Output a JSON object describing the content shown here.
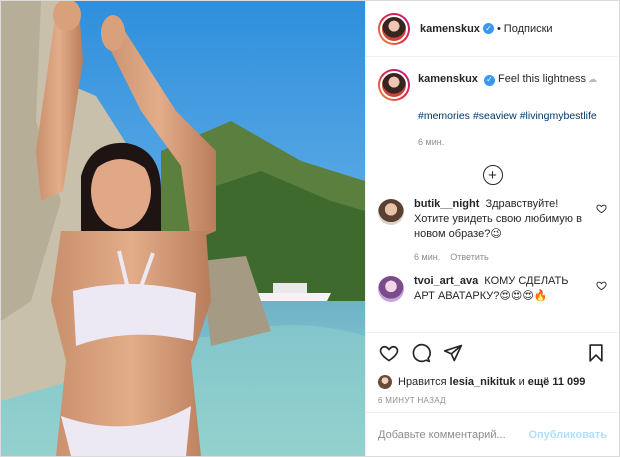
{
  "post": {
    "username": "kamenskux",
    "follow_label": "Подписки",
    "separator": "•"
  },
  "caption": {
    "username": "kamenskux",
    "text": "Feel this lightness",
    "hashtags": [
      "#memories",
      "#seaview",
      "#livingmybestlife"
    ],
    "time": "6 мин."
  },
  "comments": [
    {
      "username": "butik__night",
      "text": "Здравствуйте! Хотите увидеть свою любимую в новом образе?😉",
      "time": "6 мин.",
      "reply_label": "Ответить"
    },
    {
      "username": "tvoi_art_ava",
      "text": "КОМУ СДЕЛАТЬ АРТ АВАТАРКУ?😍😍😍🔥",
      "time": "",
      "reply_label": ""
    }
  ],
  "likes": {
    "prefix": "Нравится",
    "user": "lesia_nikituk",
    "conjunction": "и",
    "others": "ещё 11 099"
  },
  "timestamp": "6 МИНУТ НАЗАД",
  "comment_input": {
    "placeholder": "Добавьте комментарий...",
    "publish_label": "Опубликовать"
  },
  "icons": {
    "verified": "verified-badge-icon",
    "like": "heart-icon",
    "comment": "comment-bubble-icon",
    "share": "paper-plane-icon",
    "save": "bookmark-icon",
    "load_more": "plus-circle-icon"
  },
  "colors": {
    "verified_blue": "#3897f0",
    "hashtag_link": "#00376b",
    "publish_disabled": "#b2dffc"
  }
}
